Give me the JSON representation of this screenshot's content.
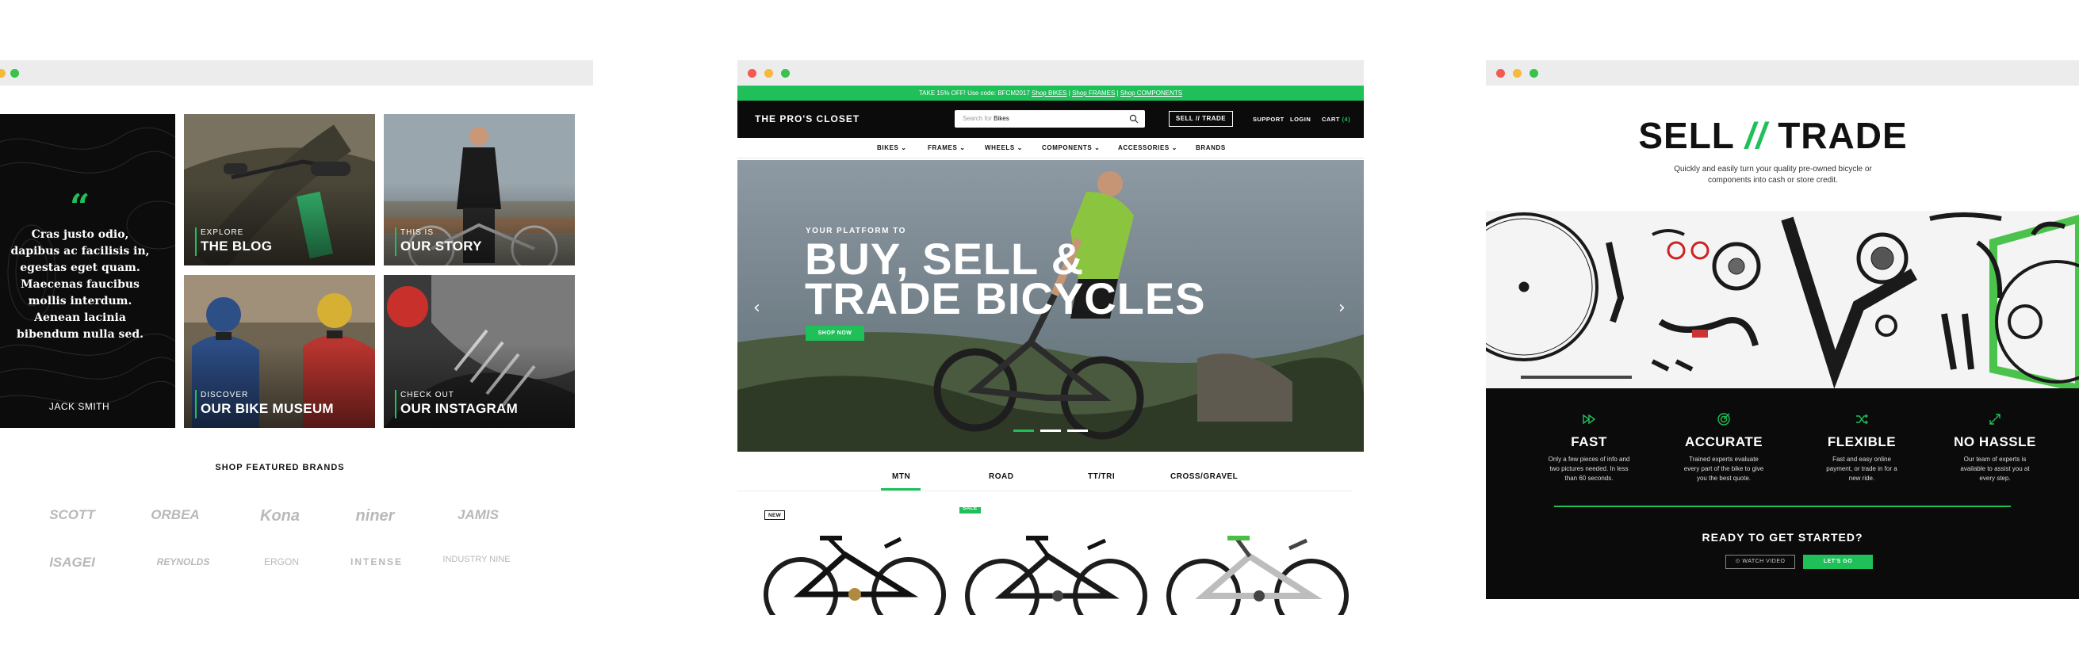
{
  "colors": {
    "accent": "#1fbf5a",
    "dark": "#0b0b0b",
    "title_bar": "#ececec"
  },
  "window_left": {
    "quote": {
      "mark_icon": "quote-icon",
      "text": "Cras justo odio, dapibus ac facilisis in, egestas eget quam. Maecenas faucibus mollis interdum. Aenean lacinia bibendum nulla sed.",
      "author": "JACK SMITH"
    },
    "tiles": [
      {
        "kicker": "EXPLORE",
        "title": "THE BLOG"
      },
      {
        "kicker": "THIS IS",
        "title": "OUR STORY"
      },
      {
        "kicker": "DISCOVER",
        "title": "OUR BIKE MUSEUM"
      },
      {
        "kicker": "CHECK OUT",
        "title": "OUR INSTAGRAM"
      }
    ],
    "featured_title": "SHOP FEATURED BRANDS",
    "brands": [
      "SCOTT",
      "ORBEA",
      "Kona",
      "niner",
      "JAMIS",
      "ISAGEI",
      "REYNOLDS",
      "ERGON",
      "INTENSE",
      "INDUSTRY NINE"
    ]
  },
  "window_center": {
    "promo": {
      "text": "TAKE 15% OFF! Use code: BFCM2017",
      "link1": "Shop BIKES",
      "sep": "|",
      "link2": "Shop FRAMES",
      "link3": "Shop COMPONENTS"
    },
    "nav": {
      "logo": "THE PRO'S CLOSET",
      "search_placeholder": "Search for",
      "search_value": "Bikes",
      "sell_trade": "SELL // TRADE",
      "support": "SUPPORT",
      "login": "LOGIN",
      "cart": "CART",
      "cart_count": "(4)"
    },
    "categories": [
      "BIKES",
      "FRAMES",
      "WHEELS",
      "COMPONENTS",
      "ACCESSORIES",
      "BRANDS"
    ],
    "hero": {
      "kicker": "YOUR PLATFORM TO",
      "title_line1": "BUY, SELL &",
      "title_line2": "TRADE BICYCLES",
      "cta": "SHOP NOW",
      "prev_icon": "‹",
      "next_icon": "›",
      "slides_total": 3,
      "active_slide": 1
    },
    "tabs": [
      "MTN",
      "ROAD",
      "TT/TRI",
      "CROSS/GRAVEL"
    ],
    "active_tab": "MTN",
    "products": [
      {
        "badge": "NEW"
      },
      {
        "badge": "SALE"
      },
      {
        "badge": ""
      }
    ]
  },
  "window_right": {
    "title_left": "SELL",
    "title_slash": "//",
    "title_right": "TRADE",
    "subtitle": "Quickly and easily turn your quality pre-owned bicycle or components into cash or store credit.",
    "features": [
      {
        "icon": "fast-forward-icon",
        "title": "FAST",
        "text": "Only a few pieces of info and two pictures needed. In less than 60 seconds."
      },
      {
        "icon": "target-icon",
        "title": "ACCURATE",
        "text": "Trained experts evaluate every part of the bike to give you the best quote."
      },
      {
        "icon": "shuffle-icon",
        "title": "FLEXIBLE",
        "text": "Fast and easy online payment, or trade in for a new ride."
      },
      {
        "icon": "arrows-icon",
        "title": "NO HASSLE",
        "text": "Our team of experts is available to assist you at every step."
      }
    ],
    "ready": "READY TO GET STARTED?",
    "watch_video": "WATCH VIDEO",
    "lets_go": "LET'S GO"
  }
}
